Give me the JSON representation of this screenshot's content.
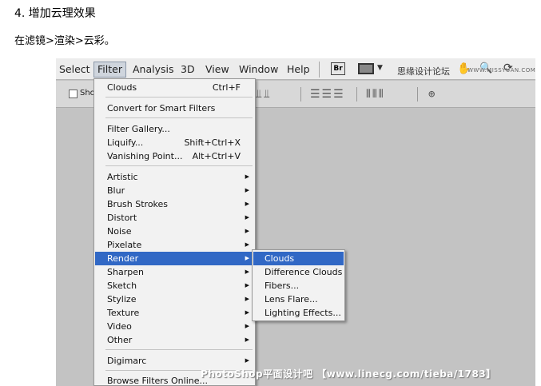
{
  "article": {
    "step_title": "4. 增加云理效果",
    "step_desc": "在滤镜>渲染>云彩。"
  },
  "menubar": {
    "items": [
      {
        "label": "Select"
      },
      {
        "label": "Filter"
      },
      {
        "label": "Analysis"
      },
      {
        "label": "3D"
      },
      {
        "label": "View"
      },
      {
        "label": "Window"
      },
      {
        "label": "Help"
      }
    ],
    "br_label": "Br",
    "site_text": "思缘设计论坛",
    "site_url": "WWW.MISSYUAN.COM"
  },
  "options_bar": {
    "show_label": "Sho"
  },
  "filter_menu": {
    "top_items": [
      {
        "label": "Clouds",
        "shortcut": "Ctrl+F"
      },
      {
        "label": "Convert for Smart Filters",
        "shortcut": ""
      },
      {
        "label": "Filter Gallery...",
        "shortcut": ""
      },
      {
        "label": "Liquify...",
        "shortcut": "Shift+Ctrl+X"
      },
      {
        "label": "Vanishing Point...",
        "shortcut": "Alt+Ctrl+V"
      }
    ],
    "submenu_items": [
      {
        "label": "Artistic"
      },
      {
        "label": "Blur"
      },
      {
        "label": "Brush Strokes"
      },
      {
        "label": "Distort"
      },
      {
        "label": "Noise"
      },
      {
        "label": "Pixelate"
      },
      {
        "label": "Render"
      },
      {
        "label": "Sharpen"
      },
      {
        "label": "Sketch"
      },
      {
        "label": "Stylize"
      },
      {
        "label": "Texture"
      },
      {
        "label": "Video"
      },
      {
        "label": "Other"
      }
    ],
    "highlighted": "Render",
    "bottom_items": [
      {
        "label": "Digimarc"
      },
      {
        "label": "Browse Filters Online..."
      }
    ],
    "arrow_glyph": "▶"
  },
  "render_submenu": {
    "items": [
      {
        "label": "Clouds"
      },
      {
        "label": "Difference Clouds"
      },
      {
        "label": "Fibers..."
      },
      {
        "label": "Lens Flare..."
      },
      {
        "label": "Lighting Effects..."
      }
    ],
    "highlighted": "Clouds"
  },
  "watermark": "PhotoShop平面设计吧 【www.linecg.com/tieba/1783】",
  "colors": {
    "highlight": "#3168c5",
    "canvas": "#c3c3c3",
    "menu_bg": "#f2f2f2"
  }
}
